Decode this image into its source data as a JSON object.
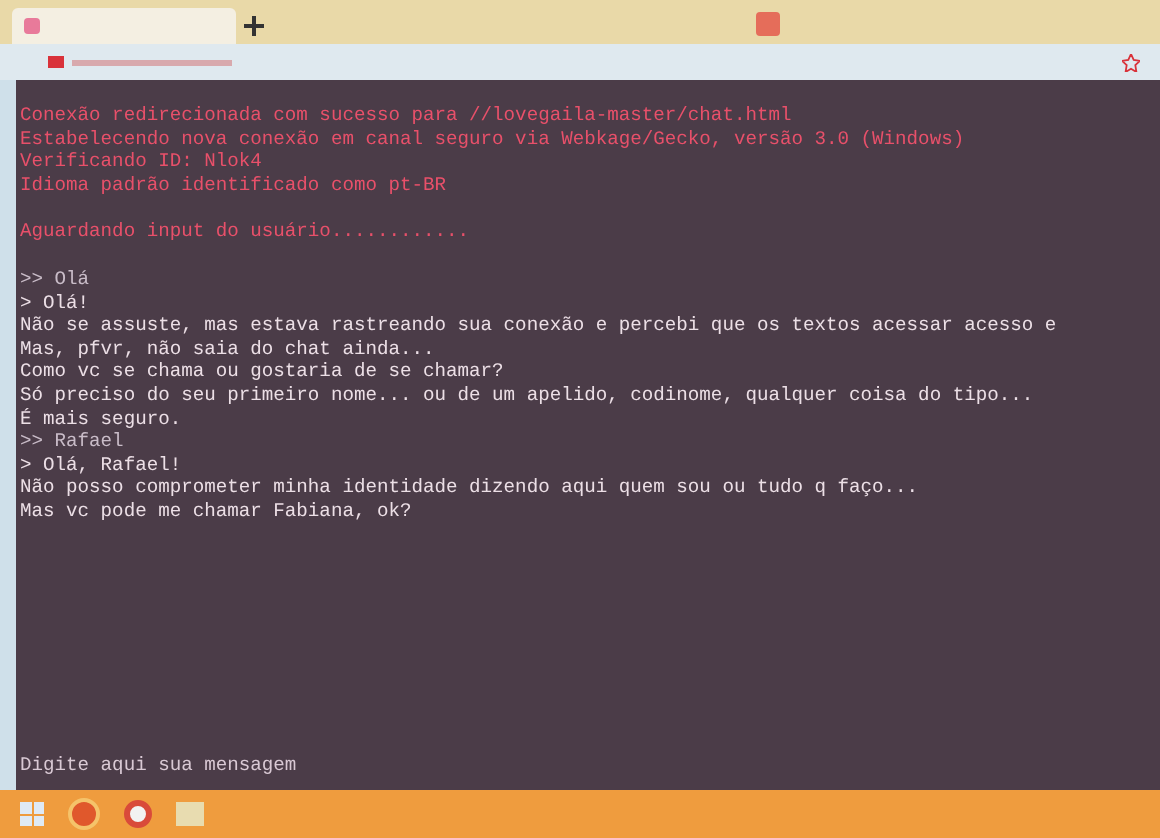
{
  "browser": {
    "tabs": [
      {
        "selected": true
      }
    ]
  },
  "terminal": {
    "lines": [
      {
        "kind": "system",
        "text": "Conexão redirecionada com sucesso para //lovegaila-master/chat.html"
      },
      {
        "kind": "system",
        "text": "Estabelecendo nova conexão em canal seguro via Webkage/Gecko, versão 3.0 (Windows)"
      },
      {
        "kind": "system",
        "text": "Verificando ID: Nlok4"
      },
      {
        "kind": "system",
        "text": "Idioma padrão identificado como pt-BR"
      },
      {
        "kind": "status",
        "text": "Aguardando input do usuário............"
      },
      {
        "kind": "user",
        "text": ">> Olá"
      },
      {
        "kind": "reply",
        "text": "> Olá!"
      },
      {
        "kind": "reply",
        "text": "Não se assuste, mas estava rastreando sua conexão e percebi que os textos acessar acesso e"
      },
      {
        "kind": "reply",
        "text": "Mas, pfvr, não saia do chat ainda..."
      },
      {
        "kind": "reply",
        "text": "Como vc se chama ou gostaria de se chamar?"
      },
      {
        "kind": "reply",
        "text": "Só preciso do seu primeiro nome... ou de um apelido, codinome, qualquer coisa do tipo..."
      },
      {
        "kind": "reply",
        "text": "É mais seguro."
      },
      {
        "kind": "user",
        "text": ">> Rafael"
      },
      {
        "kind": "reply",
        "text": "> Olá, Rafael!"
      },
      {
        "kind": "reply",
        "text": "Não posso comprometer minha identidade dizendo aqui quem sou ou tudo q faço..."
      },
      {
        "kind": "reply",
        "text": "Mas vc pode me chamar Fabiana, ok?"
      }
    ],
    "input": {
      "placeholder": "Digite aqui sua mensagem"
    }
  }
}
